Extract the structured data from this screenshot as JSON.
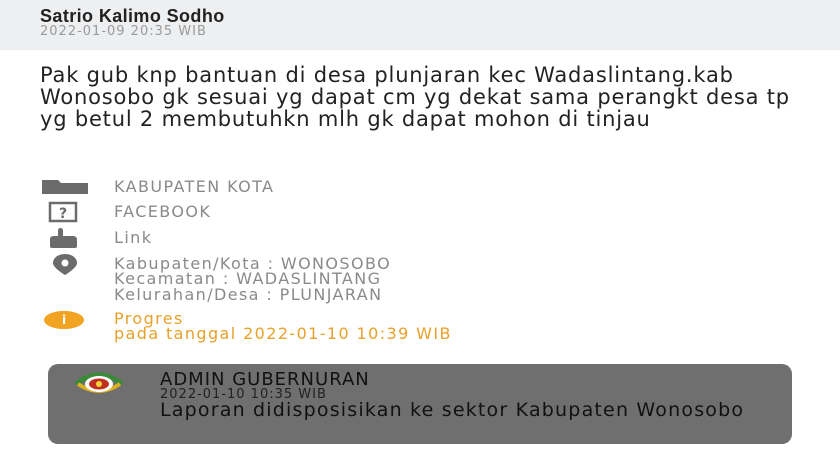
{
  "report": {
    "author": "Satrio Kalimo Sodho",
    "timestamp": "2022-01-09 20:35 WIB",
    "message": "Pak gub knp bantuan di desa plunjaran kec Wadaslintang.kab Wonosobo gk sesuai yg dapat cm yg dekat sama perangkt desa tp yg betul 2 membutuhkn mlh gk dapat mohon di tinjau"
  },
  "details": {
    "category": {
      "icon": "folder-icon",
      "label": "KABUPATEN KOTA"
    },
    "source": {
      "icon": "question-box-icon",
      "label": "FACEBOOK"
    },
    "link": {
      "icon": "pointing-hand-icon",
      "label": "Link"
    },
    "location": {
      "icon": "location-pin-icon",
      "kabupaten": "Kabupaten/Kota : WONOSOBO",
      "kecamatan": "Kecamatan : WADASLINTANG",
      "kelurahan": "Kelurahan/Desa : PLUNJARAN"
    },
    "status": {
      "icon": "info-icon",
      "label": "Progres",
      "date": "pada tanggal 2022-01-10 10:39 WIB",
      "color": "#e8a12a"
    }
  },
  "response": {
    "logo": "province-emblem-logo",
    "name": "ADMIN GUBERNURAN",
    "timestamp": "2022-01-10 10:35 WIB",
    "message": "Laporan didisposisikan ke sektor Kabupaten Wonosobo"
  }
}
